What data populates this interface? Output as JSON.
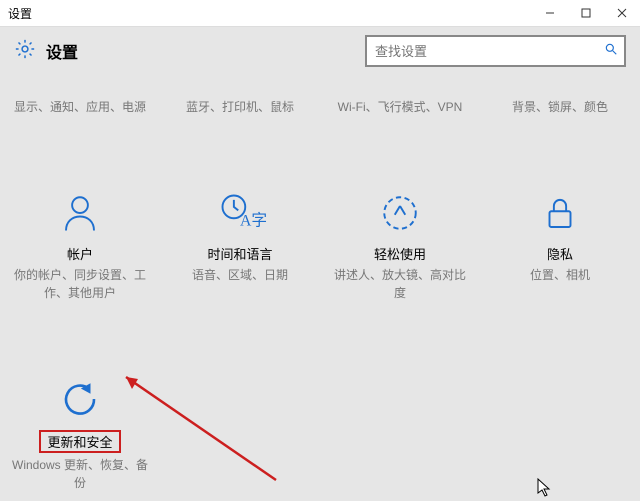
{
  "window": {
    "title": "设置",
    "brand": "设置",
    "search_placeholder": "查找设置"
  },
  "row1": [
    {
      "sub": "显示、通知、应用、电源"
    },
    {
      "sub": "蓝牙、打印机、鼠标"
    },
    {
      "sub": "Wi-Fi、飞行模式、VPN"
    },
    {
      "sub": "背景、锁屏、颜色"
    }
  ],
  "row2": [
    {
      "title": "帐户",
      "sub": "你的帐户、同步设置、工作、其他用户"
    },
    {
      "title": "时间和语言",
      "sub": "语音、区域、日期"
    },
    {
      "title": "轻松使用",
      "sub": "讲述人、放大镜、高对比度"
    },
    {
      "title": "隐私",
      "sub": "位置、相机"
    }
  ],
  "update": {
    "title": "更新和安全",
    "sub": "Windows 更新、恢复、备份"
  }
}
